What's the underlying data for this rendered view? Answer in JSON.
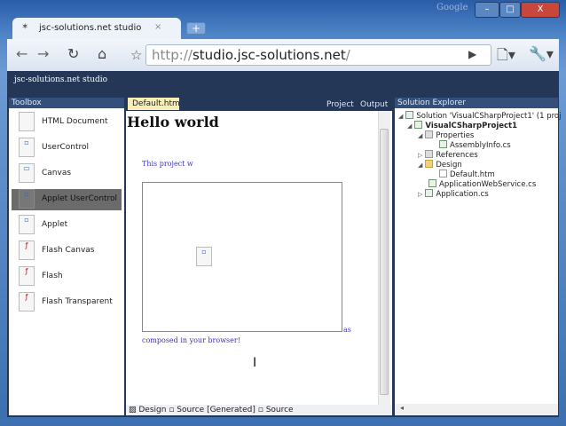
{
  "browser": {
    "brand": "Google",
    "tab_title": "jsc-solutions.net studio",
    "url_scheme": "http://",
    "url_host": "studio.jsc-solutions.net",
    "url_path": "/"
  },
  "app": {
    "title": "jsc-solutions.net studio"
  },
  "toolbox": {
    "title": "Toolbox",
    "items": [
      {
        "label": "HTML Document"
      },
      {
        "label": "UserControl"
      },
      {
        "label": "Canvas"
      },
      {
        "label": "Applet UserControl",
        "selected": true
      },
      {
        "label": "Applet"
      },
      {
        "label": "Flash Canvas"
      },
      {
        "label": "Flash"
      },
      {
        "label": "Flash Transparent"
      }
    ]
  },
  "editor": {
    "tab": "Default.htm",
    "project": "Project",
    "output": "Output",
    "heading": "Hello world",
    "text1": "This project w",
    "text2": "as",
    "text3": "composed in your browser!",
    "views": [
      "Design",
      "Source [Generated]",
      "Source"
    ]
  },
  "solution": {
    "title": "Solution Explorer",
    "nodes": [
      "Solution 'VisualCSharpProject1' (1 proj",
      "VisualCSharpProject1",
      "Properties",
      "AssemblyInfo.cs",
      "References",
      "Design",
      "Default.htm",
      "ApplicationWebService.cs",
      "Application.cs"
    ]
  },
  "colors": {
    "app_bg": "#243756",
    "selected": "#6b6b6b",
    "link": "#3a32c0"
  }
}
